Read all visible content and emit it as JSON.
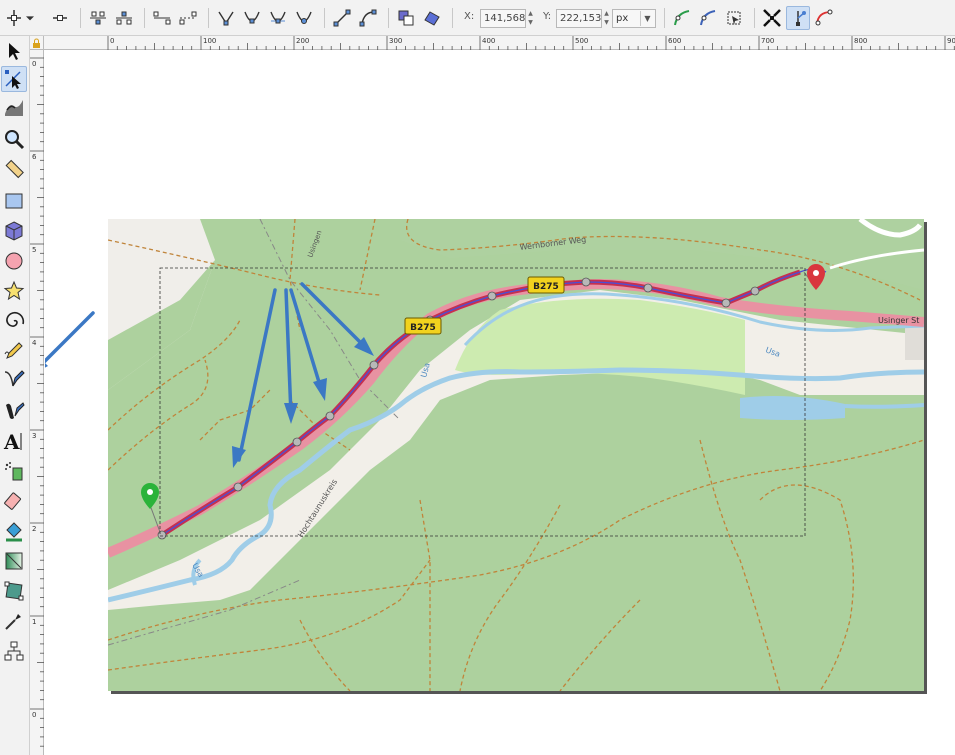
{
  "toolbar": {
    "x_label": "X:",
    "x_value": "141,568",
    "y_label": "Y:",
    "y_value": "222,153",
    "unit": "px",
    "icons": [
      "node-insert-icon",
      "chevron-down-icon",
      "node-delete-icon",
      "join-nodes-icon",
      "break-path-icon",
      "join-segment-icon",
      "delete-segment-icon",
      "cusp-node-icon",
      "smooth-node-icon",
      "symmetric-node-icon",
      "auto-smooth-icon",
      "segment-line-icon",
      "segment-curve-icon",
      "object-to-path-icon",
      "stroke-to-path-icon",
      "show-clip-icon",
      "show-mask-icon",
      "show-transform-handles-icon",
      "show-path-outline-icon",
      "show-handles-icon"
    ]
  },
  "ruler_top": {
    "labels": [
      "0",
      "100",
      "200",
      "300",
      "400",
      "500",
      "600",
      "700",
      "800",
      "900"
    ]
  },
  "ruler_left": {
    "labels": [
      "0",
      "6",
      "5",
      "4",
      "3",
      "2",
      "1",
      "0"
    ]
  },
  "tools": [
    {
      "name": "selector-tool",
      "icon": "arrow-icon"
    },
    {
      "name": "node-tool",
      "icon": "node-editor-icon"
    },
    {
      "name": "tweak-tool",
      "icon": "tweak-icon"
    },
    {
      "name": "zoom-tool",
      "icon": "magnifier-icon"
    },
    {
      "name": "measure-tool",
      "icon": "ruler-icon"
    },
    {
      "name": "rect-tool",
      "icon": "rectangle-icon"
    },
    {
      "name": "3dbox-tool",
      "icon": "box-3d-icon"
    },
    {
      "name": "ellipse-tool",
      "icon": "circle-icon"
    },
    {
      "name": "star-tool",
      "icon": "star-icon"
    },
    {
      "name": "spiral-tool",
      "icon": "spiral-icon"
    },
    {
      "name": "pencil-tool",
      "icon": "pencil-icon"
    },
    {
      "name": "pen-tool",
      "icon": "pen-bezier-icon"
    },
    {
      "name": "calligraphy-tool",
      "icon": "calligraphy-icon"
    },
    {
      "name": "text-tool",
      "icon": "text-icon"
    },
    {
      "name": "spray-tool",
      "icon": "spray-icon"
    },
    {
      "name": "eraser-tool",
      "icon": "eraser-icon"
    },
    {
      "name": "paint-bucket-tool",
      "icon": "paint-bucket-icon"
    },
    {
      "name": "gradient-tool",
      "icon": "gradient-icon"
    },
    {
      "name": "mesh-tool",
      "icon": "mesh-icon"
    },
    {
      "name": "dropper-tool",
      "icon": "dropper-icon"
    },
    {
      "name": "connector-tool",
      "icon": "connector-icon"
    }
  ],
  "map": {
    "labels": {
      "road_top": "Wernborner Weg",
      "road_right": "Usinger St",
      "river_1": "Usa",
      "river_2": "Usa",
      "river_3": "Usa",
      "path_1": "Usingen",
      "path_2": "Hochtaunuskreis",
      "shield_1": "B275",
      "shield_2": "B275"
    },
    "colors": {
      "forest": "#add19e",
      "meadow": "#cdebb0",
      "water": "#9fcde8",
      "road": "#e892a2",
      "track": "#c5304f",
      "route": "#4a4fd6",
      "annotation": "#3b78c4",
      "start_pin": "#2bb33a",
      "end_pin": "#d9363e"
    },
    "markers": [
      "start-pin-icon",
      "end-pin-icon"
    ]
  }
}
